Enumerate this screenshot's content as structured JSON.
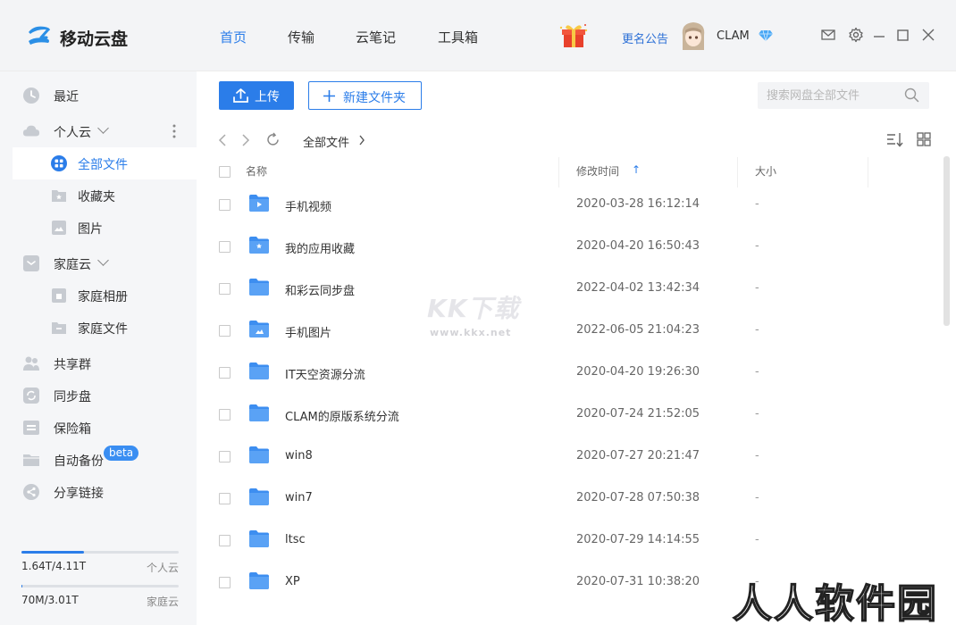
{
  "app": {
    "name": "移动云盘",
    "nav_tabs": [
      {
        "label": "首页",
        "active": true
      },
      {
        "label": "传输"
      },
      {
        "label": "云笔记"
      },
      {
        "label": "工具箱"
      }
    ],
    "notice": "更名公告",
    "username": "CLAM",
    "icons": [
      "gift-icon",
      "diamond-icon",
      "mail-icon",
      "gear-icon",
      "minimize-icon",
      "maximize-icon",
      "close-icon"
    ]
  },
  "sidebar": {
    "items": [
      {
        "label": "最近",
        "icon": "clock-icon"
      },
      {
        "label": "个人云",
        "icon": "cloud-icon"
      },
      {
        "label": "全部文件",
        "icon": "grid-icon",
        "selected": true
      },
      {
        "label": "收藏夹",
        "icon": "star-folder-icon"
      },
      {
        "label": "图片",
        "icon": "image-icon"
      },
      {
        "label": "家庭云",
        "icon": "home-cloud-icon"
      },
      {
        "label": "家庭相册",
        "icon": "album-icon"
      },
      {
        "label": "家庭文件",
        "icon": "family-folder-icon"
      },
      {
        "label": "共享群",
        "icon": "group-icon"
      },
      {
        "label": "同步盘",
        "icon": "sync-icon"
      },
      {
        "label": "保险箱",
        "icon": "safe-icon"
      },
      {
        "label": "自动备份",
        "icon": "backup-icon"
      },
      {
        "label": "分享链接",
        "icon": "share-icon"
      }
    ],
    "beta_badge": "beta",
    "storage": [
      {
        "used": "1.64T/4.11T",
        "name": "个人云",
        "fraction": 0.4
      },
      {
        "used": "70M/3.01T",
        "name": "家庭云",
        "fraction": 0.0
      }
    ]
  },
  "toolbar": {
    "upload_label": "上传",
    "new_folder_label": "新建文件夹",
    "search_placeholder": "搜索网盘全部文件"
  },
  "breadcrumb": {
    "path": "全部文件"
  },
  "table": {
    "columns": [
      "名称",
      "修改时间",
      "大小"
    ],
    "sort_indicator": "↑",
    "rows": [
      {
        "name": "手机视频",
        "date": "2020-03-28 16:12:14",
        "size": "-",
        "icon": "video-folder-icon"
      },
      {
        "name": "我的应用收藏",
        "date": "2020-04-20 16:50:43",
        "size": "-",
        "icon": "star-folder-icon"
      },
      {
        "name": "和彩云同步盘",
        "date": "2022-04-02 13:42:34",
        "size": "-",
        "icon": "folder-icon"
      },
      {
        "name": "手机图片",
        "date": "2022-06-05 21:04:23",
        "size": "-",
        "icon": "image-folder-icon"
      },
      {
        "name": "IT天空资源分流",
        "date": "2020-04-20 19:26:30",
        "size": "-",
        "icon": "folder-icon"
      },
      {
        "name": "CLAM的原版系统分流",
        "date": "2020-07-24 21:52:05",
        "size": "-",
        "icon": "folder-icon"
      },
      {
        "name": "win8",
        "date": "2020-07-27 20:21:47",
        "size": "-",
        "icon": "folder-icon"
      },
      {
        "name": "win7",
        "date": "2020-07-28 07:50:38",
        "size": "-",
        "icon": "folder-icon"
      },
      {
        "name": "ltsc",
        "date": "2020-07-29 14:14:55",
        "size": "-",
        "icon": "folder-icon"
      },
      {
        "name": "XP",
        "date": "2020-07-31 10:38:20",
        "size": "-",
        "icon": "folder-icon"
      }
    ]
  },
  "watermarks": {
    "kk": "KK下载",
    "kk_url": "www.kkx.net",
    "rr": "人人软件园"
  },
  "colors": {
    "accent": "#2b7de9",
    "folder": "#4a90f0",
    "sidebar_bg": "#f5f6f8",
    "titlebar_bg": "#f3f4f6"
  }
}
